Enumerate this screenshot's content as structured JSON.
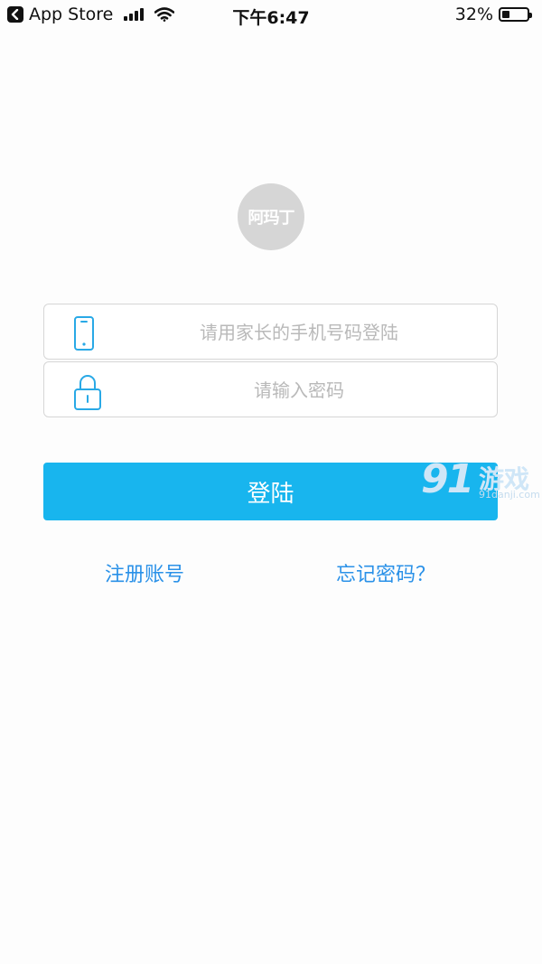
{
  "status_bar": {
    "back_app": "App Store",
    "time": "下午6:47",
    "battery": "32%",
    "battery_level": 0.32
  },
  "logo": {
    "text": "阿玛丁"
  },
  "form": {
    "phone_placeholder": "请用家长的手机号码登陆",
    "phone_value": "",
    "password_placeholder": "请输入密码",
    "password_value": ""
  },
  "actions": {
    "login_label": "登陆",
    "register_label": "注册账号",
    "forgot_label": "忘记密码？"
  },
  "watermark": {
    "number": "91",
    "game": "游戏",
    "domain": "91danji.com"
  },
  "colors": {
    "accent": "#18b5ee",
    "link": "#2a91e8",
    "icon": "#29a9e6",
    "placeholder": "#b9b9b9"
  }
}
